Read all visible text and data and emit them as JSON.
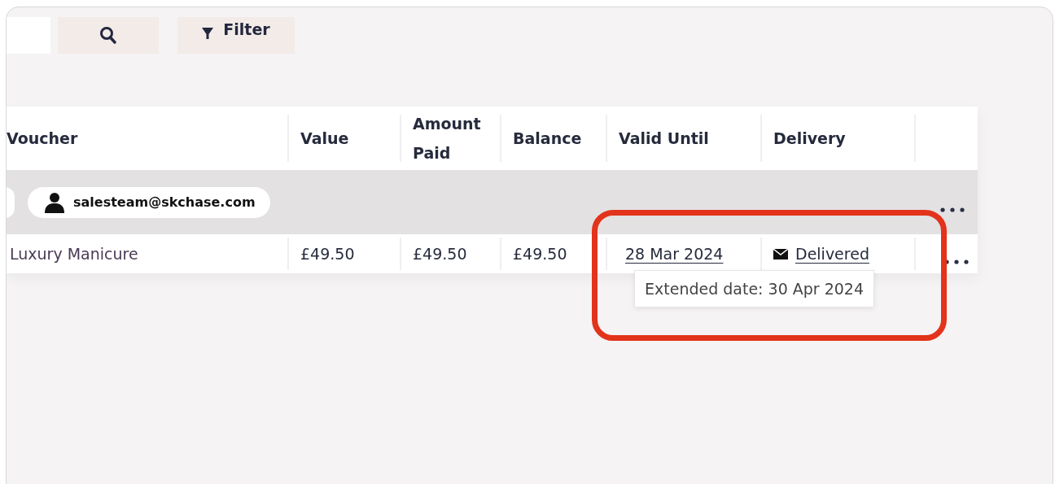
{
  "toolbar": {
    "filter_button": "Filter"
  },
  "table": {
    "columns": [
      "Voucher",
      "Value",
      "Amount Paid",
      "Balance",
      "Valid Until",
      "Delivery"
    ],
    "group": {
      "email": "salesteam@skchase.com"
    },
    "rows": [
      {
        "voucher": "Luxury Manicure",
        "value": "£49.50",
        "amount_paid": "£49.50",
        "balance": "£49.50",
        "valid_until": "28 Mar 2024",
        "delivery": "Delivered"
      }
    ]
  },
  "tooltip": "Extended date: 30 Apr 2024"
}
